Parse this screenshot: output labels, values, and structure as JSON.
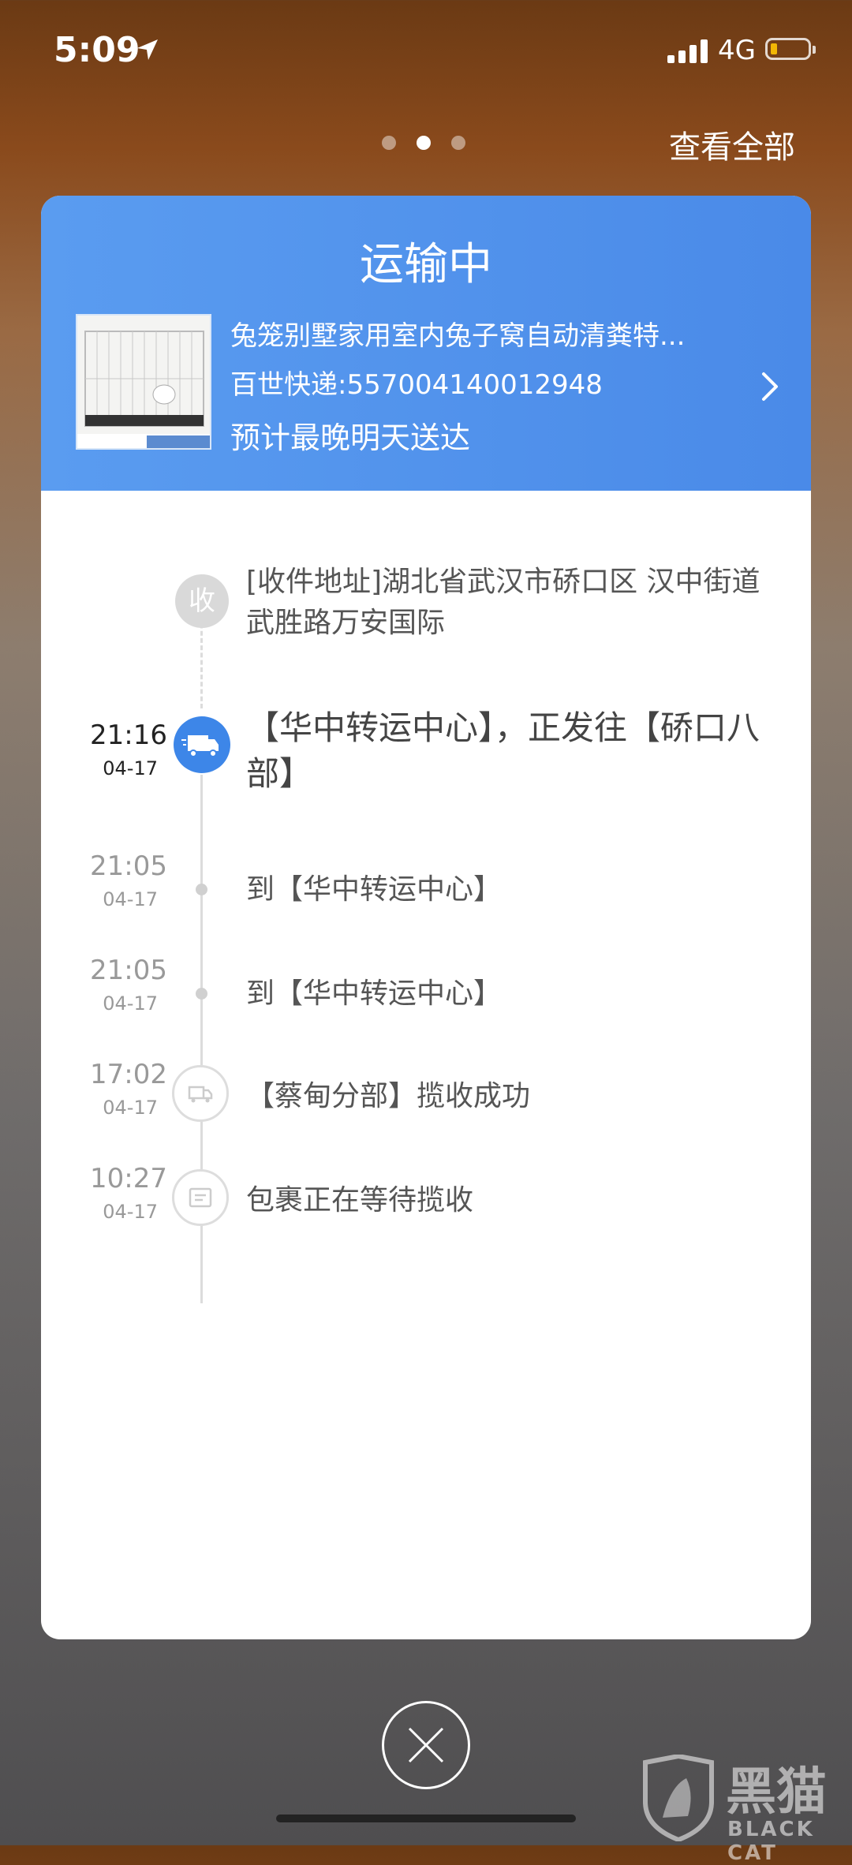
{
  "status_bar": {
    "time": "5:09",
    "network": "4G",
    "battery_fraction": 0.12
  },
  "top": {
    "view_all": "查看全部",
    "page_count": 3,
    "active_page": 2
  },
  "card": {
    "title": "运输中",
    "product_name": "兔笼别墅家用室内兔子窝自动清粪特...",
    "tracking": "百世快递:557004140012948",
    "eta": "预计最晚明天送达"
  },
  "timeline": {
    "receiver": {
      "badge": "收",
      "text": "[收件地址]湖北省武汉市硚口区 汉中街道  武胜路万安国际"
    },
    "events": [
      {
        "time": "21:16",
        "date": "04-17",
        "text": "【华中转运中心】，正发往【硚口八部】",
        "icon": "truck-icon",
        "active": true
      },
      {
        "time": "21:05",
        "date": "04-17",
        "text": "到【华中转运中心】",
        "icon": "dot",
        "active": false
      },
      {
        "time": "21:05",
        "date": "04-17",
        "text": "到【华中转运中心】",
        "icon": "dot",
        "active": false
      },
      {
        "time": "17:02",
        "date": "04-17",
        "text": "【蔡甸分部】揽收成功",
        "icon": "truck-outline-icon",
        "active": false
      },
      {
        "time": "10:27",
        "date": "04-17",
        "text": "包裹正在等待揽收",
        "icon": "package-icon",
        "active": false
      }
    ]
  },
  "colors": {
    "header_blue": "#4a8ae8",
    "active_node": "#3d86e8"
  }
}
